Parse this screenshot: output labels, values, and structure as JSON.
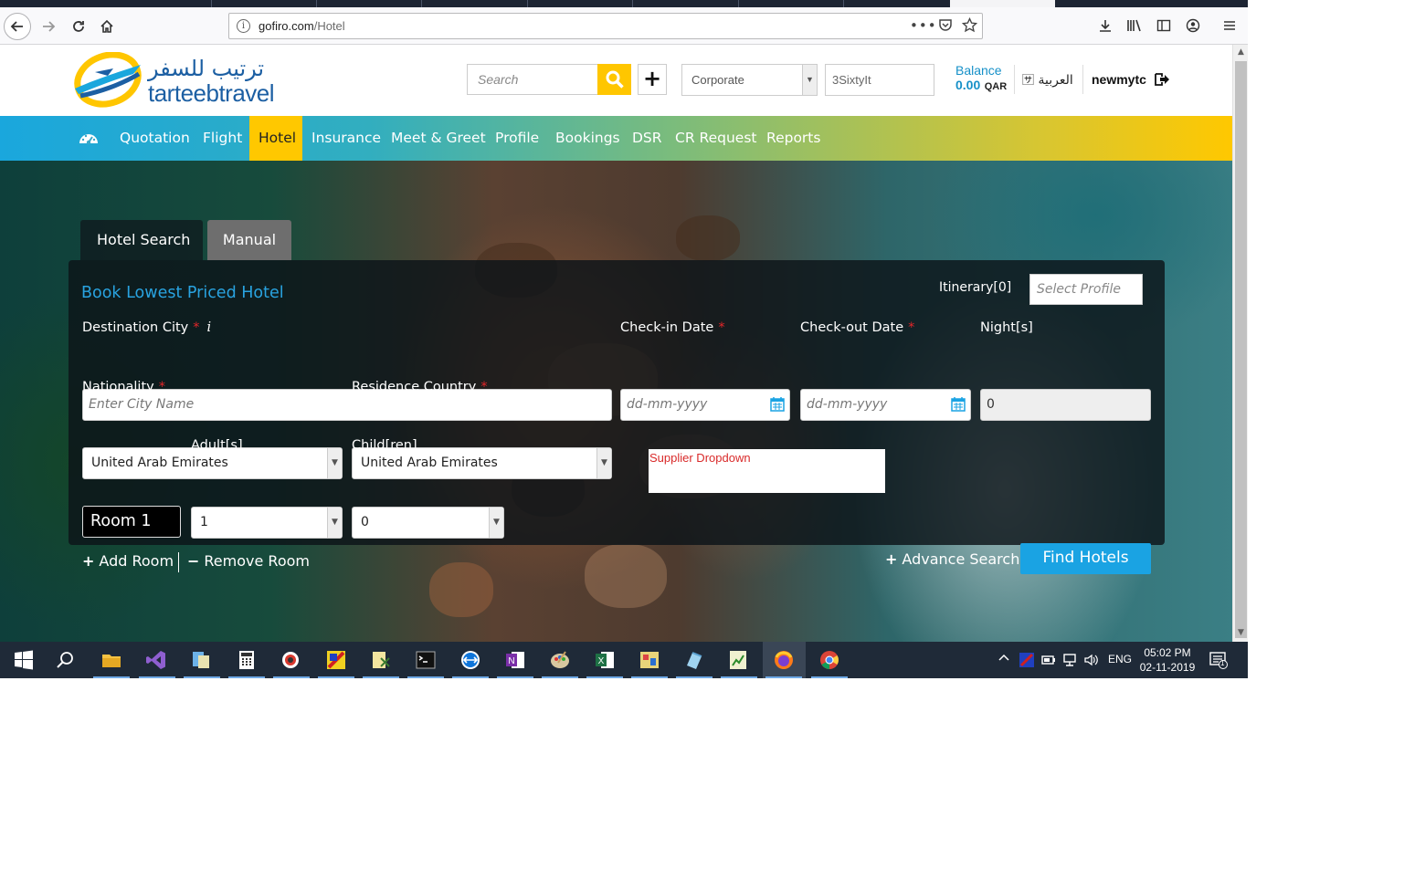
{
  "browser": {
    "url_domain": "gofiro.com",
    "url_path": "/Hotel",
    "more_icon": "ellipsis-icon"
  },
  "header": {
    "logo_arabic": "ترتيب للسفر",
    "logo_latin": "tarteebtravel",
    "search_placeholder": "Search",
    "account_type": "Corporate",
    "agency_code": "3SixtyIt",
    "balance_label": "Balance",
    "balance_amount": "0.00",
    "balance_currency": "QAR",
    "language": "العربية",
    "username": "newmytc"
  },
  "nav": {
    "items": [
      "Quotation",
      "Flight",
      "Hotel",
      "Insurance",
      "Meet & Greet",
      "Profile",
      "Bookings",
      "DSR",
      "CR Request",
      "Reports"
    ],
    "active": "Hotel"
  },
  "search": {
    "tab_hotel": "Hotel Search",
    "tab_manual": "Manual",
    "title": "Book Lowest Priced Hotel",
    "itinerary": "Itinerary[0]",
    "profile_placeholder": "Select Profile",
    "destination_label": "Destination City",
    "destination_info": "i",
    "destination_placeholder": "Enter City Name",
    "checkin_label": "Check-in Date",
    "checkin_placeholder": "dd-mm-yyyy",
    "checkout_label": "Check-out Date",
    "checkout_placeholder": "dd-mm-yyyy",
    "nights_label": "Night[s]",
    "nights_value": "0",
    "nationality_label": "Nationality",
    "nationality_value": "United Arab Emirates",
    "residence_label": "Residence Country",
    "residence_value": "United Arab Emirates",
    "supplier_text": "Supplier Dropdown",
    "room_label": "Room 1",
    "adults_label": "Adult[s]",
    "adults_value": "1",
    "children_label": "Child[ren]",
    "children_value": "0",
    "add_room": "Add Room",
    "remove_room": "Remove Room",
    "advance_search": "Advance Search",
    "find_button": "Find Hotels",
    "required_mark": "*"
  },
  "taskbar": {
    "language": "ENG",
    "time": "05:02 PM",
    "date": "02-11-2019",
    "notification_count": "1"
  },
  "colors": {
    "accent_blue": "#1aa3e3",
    "accent_yellow": "#ffc800",
    "required_red": "#e3262a"
  }
}
